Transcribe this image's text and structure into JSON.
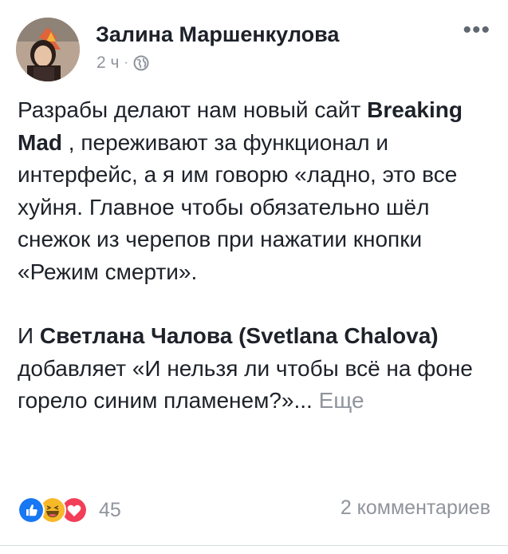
{
  "post": {
    "author": "Залина Маршенкулова",
    "time": "2 ч",
    "separator": "·",
    "audience_icon": "globe-icon",
    "more_label": "•••",
    "paragraph1": {
      "part1": "Разрабы делают нам новый сайт ",
      "mention": "Breaking Mad",
      "part2": " , переживают  за функционал и интерфейс, а я им говорю «ладно, это все хуйня. Главное чтобы обязательно шёл снежок из черепов при нажатии кнопки «Режим смерти»."
    },
    "paragraph2": {
      "part1": "И ",
      "mention": "Светлана Чалова (Svetlana Chalova)",
      "part2": " добавляет «И нельзя ли чтобы всё на фоне горело синим пламенем?»... ",
      "see_more": "Еще"
    }
  },
  "footer": {
    "reaction_icons": [
      "like-icon",
      "haha-icon",
      "love-icon"
    ],
    "reactions_count": "45",
    "comments": "2 комментариев"
  },
  "colors": {
    "text": "#1d2129",
    "secondary": "#90949c",
    "like": "#1877f2",
    "haha": "#f7b928",
    "love": "#f33e58"
  }
}
